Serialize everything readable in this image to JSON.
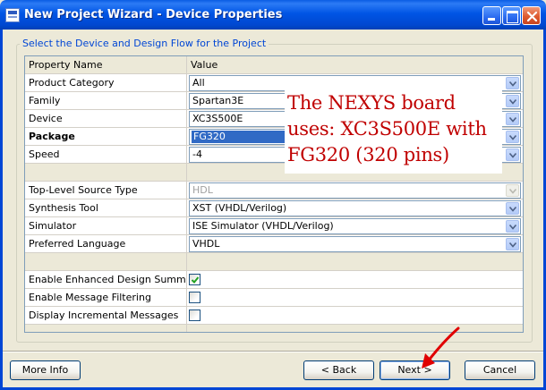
{
  "window": {
    "title": "New Project Wizard - Device Properties"
  },
  "group": {
    "title": "Select the Device and Design Flow for the Project"
  },
  "table": {
    "header": {
      "name": "Property Name",
      "value": "Value"
    },
    "rows": [
      {
        "name": "Product Category",
        "value": "All"
      },
      {
        "name": "Family",
        "value": "Spartan3E"
      },
      {
        "name": "Device",
        "value": "XC3S500E"
      },
      {
        "name": "Package",
        "value": "FG320"
      },
      {
        "name": "Speed",
        "value": "-4"
      },
      {
        "name": "Top-Level Source Type",
        "value": "HDL"
      },
      {
        "name": "Synthesis Tool",
        "value": "XST (VHDL/Verilog)"
      },
      {
        "name": "Simulator",
        "value": "ISE Simulator (VHDL/Verilog)"
      },
      {
        "name": "Preferred Language",
        "value": "VHDL"
      },
      {
        "name": "Enable Enhanced Design Summary",
        "checked": true
      },
      {
        "name": "Enable Message Filtering",
        "checked": false
      },
      {
        "name": "Display Incremental Messages",
        "checked": false
      }
    ]
  },
  "annotation": {
    "lines": [
      "The NEXYS board",
      "uses: XC3S500E with",
      "FG320 (320 pins)"
    ]
  },
  "buttons": {
    "more_info": "More Info",
    "back": "< Back",
    "next": "Next >",
    "cancel": "Cancel"
  },
  "colors": {
    "titlebar": "#0055E5",
    "group_title": "#0046D5",
    "selection": "#316AC5",
    "annotation_text": "#C00000",
    "annotation_arrow": "#E00000"
  },
  "icons": {
    "app": "project-wizard-icon",
    "dropdown": "chevron-down-icon",
    "check": "checkmark-icon",
    "pointer": "red-arrow-icon"
  }
}
